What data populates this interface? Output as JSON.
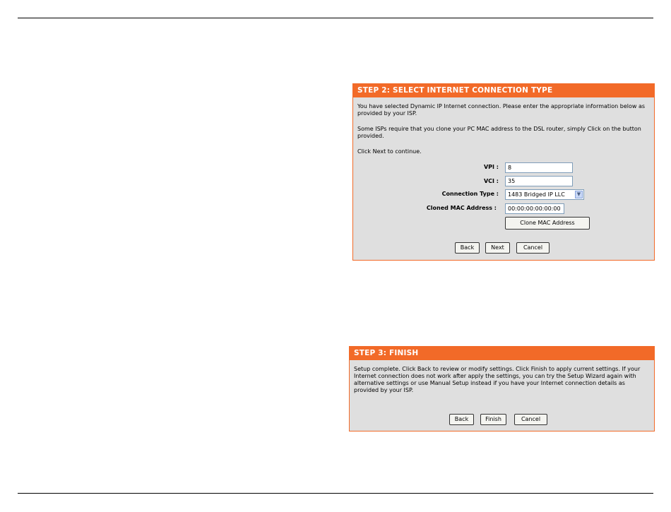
{
  "step2": {
    "title": "STEP 2: SELECT INTERNET CONNECTION TYPE",
    "para1": "You have selected Dynamic IP Internet connection. Please enter the appropriate information below as provided by your ISP.",
    "para2": "Some ISPs require that you clone your PC MAC address to the DSL router, simply Click on the button provided.",
    "para3": "Click Next to continue.",
    "vpi_label": "VPI :",
    "vpi_value": "8",
    "vci_label": "VCI :",
    "vci_value": "35",
    "conn_type_label": "Connection Type :",
    "conn_type_value": "1483 Bridged IP LLC",
    "mac_label": "Cloned MAC Address :",
    "mac_value": "00:00:00:00:00:00",
    "clone_button": "Clone MAC Address",
    "back_button": "Back",
    "next_button": "Next",
    "cancel_button": "Cancel"
  },
  "step3": {
    "title": "STEP 3: FINISH",
    "para1": "Setup complete. Click Back to review or modify settings. Click Finish to apply current settings. If your Internet connection does not work after apply the settings, you can try the Setup Wizard again with alternative settings or use Manual Setup instead if you have your Internet connection details as provided by your ISP.",
    "back_button": "Back",
    "finish_button": "Finish",
    "cancel_button": "Cancel"
  },
  "colors": {
    "accent": "#f26a28",
    "panel_bg": "#dfdfdf"
  }
}
